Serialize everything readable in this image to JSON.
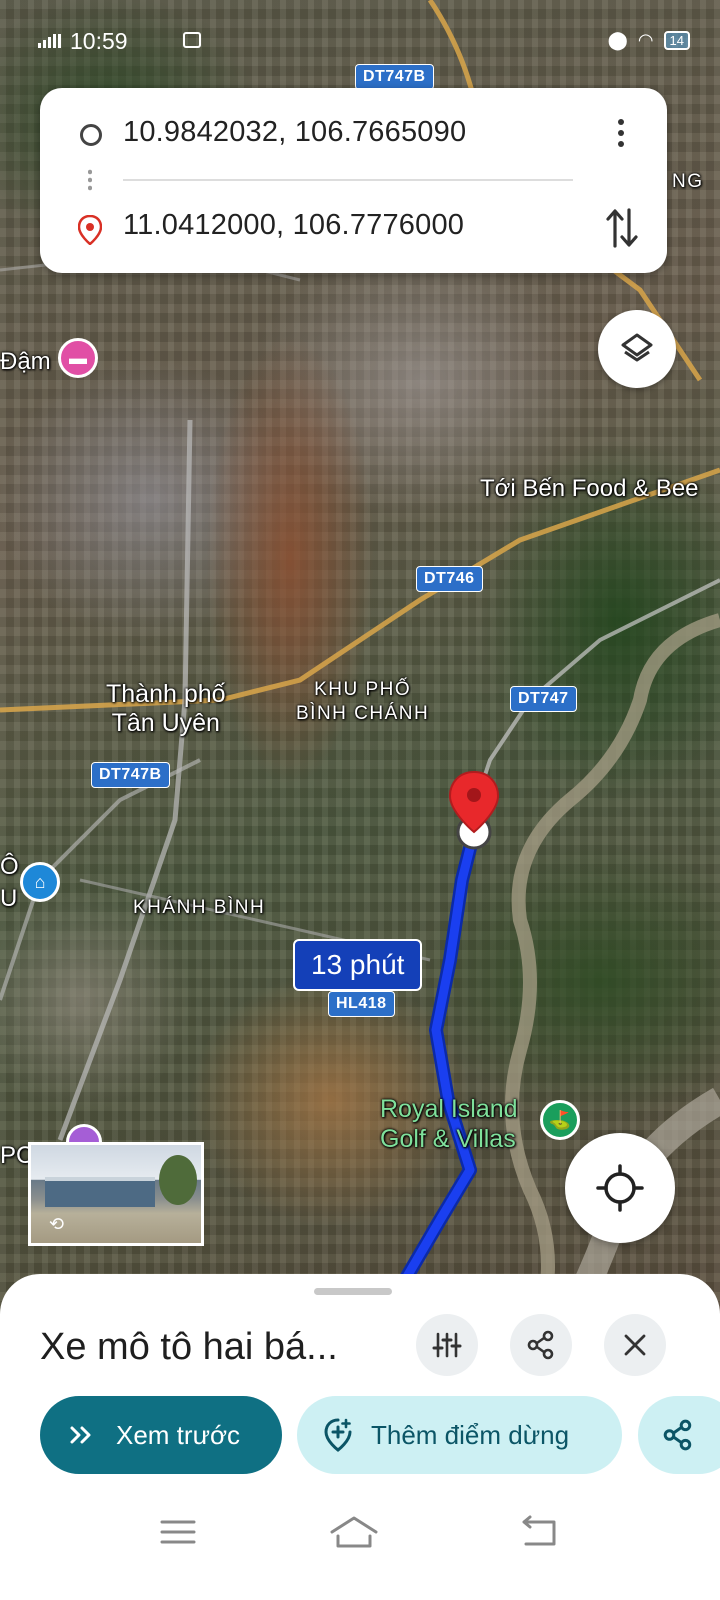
{
  "status_bar": {
    "time": "10:59",
    "battery": "14"
  },
  "route": {
    "origin": "10.9842032, 106.7665090",
    "destination": "11.0412000, 106.7776000"
  },
  "map": {
    "labels": {
      "poi_dam": "Đậm",
      "toi_ben": "Tới Bến Food & Bee",
      "city": "Thành phố\nTân Uyên",
      "khu_pho": "KHU PHỐ\nBÌNH CHÁNH",
      "khanh_binh": "KHÁNH BÌNH",
      "golf": "Royal Island\nGolf & Villas",
      "edge_ng": "NG",
      "edge_o": "Ô",
      "edge_u": "U",
      "edge_pc": "PC"
    },
    "shields": {
      "dt747b_top": "DT747B",
      "dt746": "DT746",
      "dt747": "DT747",
      "dt747b_left": "DT747B",
      "hl418": "HL418"
    },
    "duration": "13 phút",
    "route_color": "#1a3ff0",
    "pin_color": "#e8282b"
  },
  "sheet": {
    "title": "Xe mô tô hai bá...",
    "preview_label": "Xem trước",
    "add_stop_label": "Thêm điểm dừng",
    "accent_color": "#0f7083"
  }
}
